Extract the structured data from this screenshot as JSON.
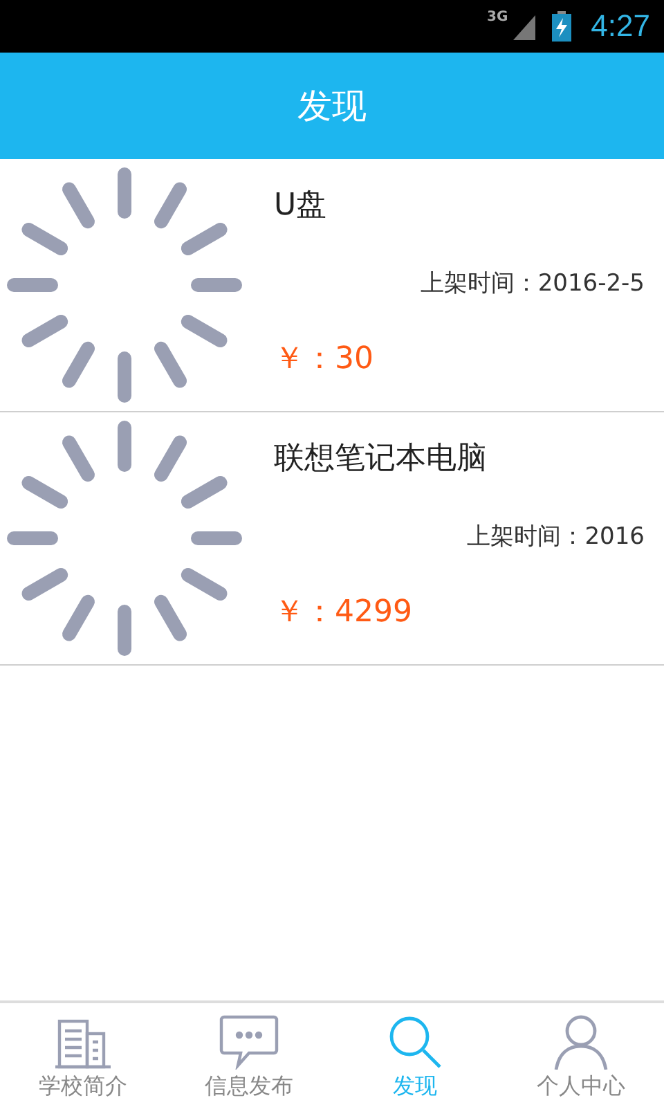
{
  "status_bar": {
    "network": "3G",
    "time": "4:27"
  },
  "header": {
    "title": "发现"
  },
  "items": [
    {
      "name": "U盘",
      "listed": "上架时间：2016-2-5",
      "price": "￥：30"
    },
    {
      "name": "联想笔记本电脑",
      "listed": "上架时间：2016",
      "price": "￥：4299"
    }
  ],
  "tabs": [
    {
      "label": "学校简介",
      "kind": "building",
      "selected": false
    },
    {
      "label": "信息发布",
      "kind": "message",
      "selected": false
    },
    {
      "label": "发现",
      "kind": "search",
      "selected": true
    },
    {
      "label": "个人中心",
      "kind": "person",
      "selected": false
    }
  ]
}
